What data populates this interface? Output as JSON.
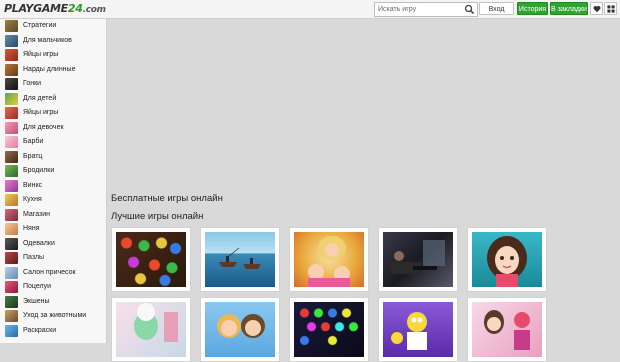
{
  "header": {
    "logo_main": "PLAYGAME",
    "logo_num": "24",
    "logo_dom": ".com",
    "search_placeholder": "Искать игру",
    "login_label": "Вход",
    "history_label": "История",
    "bookmark_label": "В закладки"
  },
  "sidebar": {
    "items": [
      {
        "label": "Стратегии",
        "icon": "strategy-thumb",
        "color": "#7a6a3a"
      },
      {
        "label": "Для мальчиков",
        "icon": "boys-thumb",
        "color": "#4a6a8a"
      },
      {
        "label": "Яйцы игры",
        "icon": "eggs-thumb",
        "color": "#b83a2a"
      },
      {
        "label": "Нарды длинные",
        "icon": "backgammon-thumb",
        "color": "#8a5a2a"
      },
      {
        "label": "Гонки",
        "icon": "racing-thumb",
        "color": "#2a2a2a"
      },
      {
        "label": "Для детей",
        "icon": "kids-thumb",
        "color": "#3a8a3a"
      },
      {
        "label": "Яйцы игры",
        "icon": "eggs2-thumb",
        "color": "#c84a3a"
      },
      {
        "label": "Для девочек",
        "icon": "girls-thumb",
        "color": "#d86a8a"
      },
      {
        "label": "Барби",
        "icon": "barbie-thumb",
        "color": "#e88aa8"
      },
      {
        "label": "Братц",
        "icon": "bratz-thumb",
        "color": "#6a4a3a"
      },
      {
        "label": "Бродилки",
        "icon": "adventure-thumb",
        "color": "#4a8a4a"
      },
      {
        "label": "Винкс",
        "icon": "winx-thumb",
        "color": "#c85aa8"
      },
      {
        "label": "Кухня",
        "icon": "kitchen-thumb",
        "color": "#d8a83a"
      },
      {
        "label": "Магазин",
        "icon": "shop-thumb",
        "color": "#a84a5a"
      },
      {
        "label": "Няня",
        "icon": "nanny-thumb",
        "color": "#e8a87a"
      },
      {
        "label": "Одевалки",
        "icon": "dressup-thumb",
        "color": "#3a3a3a"
      },
      {
        "label": "Пазлы",
        "icon": "puzzle-thumb",
        "color": "#8a3a3a"
      },
      {
        "label": "Салон причесок",
        "icon": "hair-salon-thumb",
        "color": "#8aa8c8"
      },
      {
        "label": "Поцелуи",
        "icon": "kiss-thumb",
        "color": "#c83a5a"
      },
      {
        "label": "Экшены",
        "icon": "action-thumb",
        "color": "#2a5a2a"
      },
      {
        "label": "Уход за животными",
        "icon": "pets-thumb",
        "color": "#8a6a3a"
      },
      {
        "label": "Раскраски",
        "icon": "coloring-thumb",
        "color": "#3a8ac8"
      }
    ]
  },
  "main": {
    "heading_free": "Бесплатные игры онлайн",
    "heading_best": "Лучшие игры онлайн"
  },
  "games": [
    {
      "name": "game-card-jewels",
      "theme": "match-three jewels"
    },
    {
      "name": "game-card-fishing",
      "theme": "fishing boat"
    },
    {
      "name": "game-card-barbie-babies",
      "theme": "blonde mother with twins"
    },
    {
      "name": "game-card-shooter",
      "theme": "dark action shooter"
    },
    {
      "name": "game-card-girl-portrait",
      "theme": "brown-haired girl"
    },
    {
      "name": "game-card-spa",
      "theme": "spa makeover"
    },
    {
      "name": "game-card-couple",
      "theme": "cartoon couple"
    },
    {
      "name": "game-card-bubbles",
      "theme": "colorful bubbles"
    },
    {
      "name": "game-card-simpsons",
      "theme": "cartoon family"
    },
    {
      "name": "game-card-dressup",
      "theme": "girl dress up"
    }
  ],
  "colors": {
    "accent_green": "#2fa52f",
    "page_background": "#d9d9d9"
  }
}
